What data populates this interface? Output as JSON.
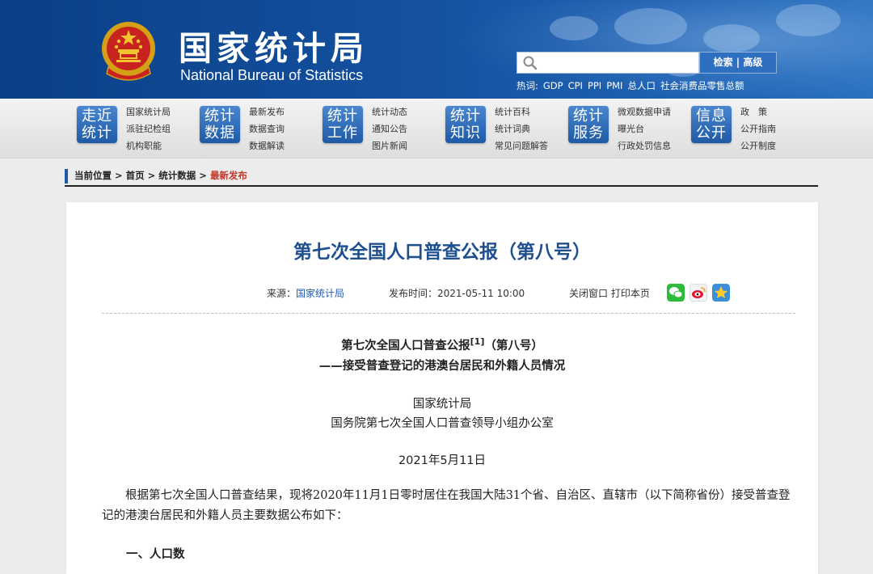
{
  "header": {
    "title_cn": "国家统计局",
    "title_en": "National Bureau of Statistics",
    "search_placeholder": "",
    "search_button": "检索 | 高级",
    "hot_label": "热词:",
    "hot_words": [
      "GDP",
      "CPI",
      "PPI",
      "PMI",
      "总人口",
      "社会消费品零售总额"
    ]
  },
  "nav": [
    {
      "badge": "走近统计",
      "badge_l1": "走近",
      "badge_l2": "统计",
      "links": [
        "国家统计局",
        "派驻纪检组",
        "机构职能"
      ]
    },
    {
      "badge": "统计数据",
      "badge_l1": "统计",
      "badge_l2": "数据",
      "links": [
        "最新发布",
        "数据查询",
        "数据解读"
      ]
    },
    {
      "badge": "统计工作",
      "badge_l1": "统计",
      "badge_l2": "工作",
      "links": [
        "统计动态",
        "通知公告",
        "图片新闻"
      ]
    },
    {
      "badge": "统计知识",
      "badge_l1": "统计",
      "badge_l2": "知识",
      "links": [
        "统计百科",
        "统计词典",
        "常见问题解答"
      ]
    },
    {
      "badge": "统计服务",
      "badge_l1": "统计",
      "badge_l2": "服务",
      "links": [
        "微观数据申请",
        "曝光台",
        "行政处罚信息"
      ]
    },
    {
      "badge": "信息公开",
      "badge_l1": "信息",
      "badge_l2": "公开",
      "links": [
        "政　策",
        "公开指南",
        "公开制度"
      ]
    }
  ],
  "breadcrumb": {
    "prefix": "当前位置 > 首页 > 统计数据 > ",
    "current": "最新发布"
  },
  "article": {
    "title": "第七次全国人口普查公报（第八号）",
    "source_label": "来源：",
    "source": "国家统计局",
    "time_label": "发布时间：",
    "time": "2021-05-11 10:00",
    "close": "关闭窗口",
    "print": "打印本页",
    "sub_title_main": "第七次全国人口普查公报",
    "sub_title_sup": "[1]",
    "sub_title_end": "（第八号）",
    "sub_title_2": "——接受普查登记的港澳台居民和外籍人员情况",
    "issuer_1": "国家统计局",
    "issuer_2": "国务院第七次全国人口普查领导小组办公室",
    "date": "2021年5月11日",
    "paragraph": "根据第七次全国人口普查结果，现将2020年11月1日零时居住在我国大陆31个省、自治区、直辖市（以下简称省份）接受普查登记的港澳台居民和外籍人员主要数据公布如下：",
    "section_1": "一、人口数"
  },
  "colors": {
    "header_blue": "#13509e",
    "title_blue": "#1e4f8f",
    "crumb_red": "#c0392b"
  }
}
